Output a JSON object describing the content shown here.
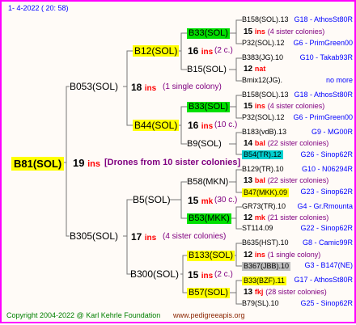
{
  "header": {
    "date": "1-   4-2022 ( 20:  58)"
  },
  "root": {
    "name": "B81(SOL)",
    "count": "19",
    "unit": "ins",
    "note": "[Drones from 10 sister colonies]"
  },
  "gen1": [
    {
      "name": "B053(SOL)",
      "count": "18",
      "unit": "ins",
      "note": "(1 single colony)"
    },
    {
      "name": "B305(SOL)",
      "count": "17",
      "unit": "ins",
      "note": "(4 sister colonies)"
    }
  ],
  "gen2": [
    {
      "name": "B12(SOL)",
      "count": "16",
      "unit": "ins",
      "note": "(2 c.)"
    },
    {
      "name": "B44(SOL)",
      "count": "16",
      "unit": "ins",
      "note": "(10 c.)"
    },
    {
      "name": "B5(SOL)",
      "count": "15",
      "unit": "mk",
      "note": "(30 c.)"
    },
    {
      "name": "B300(SOL)",
      "count": "15",
      "unit": "ins",
      "note": "(2 c.)"
    }
  ],
  "gen3": [
    {
      "name": "B33(SOL)",
      "count": "15",
      "unit": "ins",
      "note": "(4 sister colonies)"
    },
    {
      "name": "B15(SOL)",
      "count": "12",
      "unit": "nat",
      "note": ""
    },
    {
      "name": "B33(SOL)",
      "count": "15",
      "unit": "ins",
      "note": "(4 sister colonies)"
    },
    {
      "name": "B9(SOL)",
      "count": "14",
      "unit": "bal",
      "note": "(22 sister colonies)"
    },
    {
      "name": "B58(MKN)",
      "count": "13",
      "unit": "bal",
      "note": "(22 sister colonies)"
    },
    {
      "name": "B53(MKK)",
      "count": "12",
      "unit": "mk",
      "note": "(21 sister colonies)"
    },
    {
      "name": "B133(SOL)",
      "count": "12",
      "unit": "ins",
      "note": "(1 single colony)"
    },
    {
      "name": "B57(SOL)",
      "count": "13",
      "unit": "fkj",
      "note": "(28 sister colonies)"
    }
  ],
  "gen4": [
    {
      "name": "B158(SOL).13",
      "info": "G18 - AthosSt80R"
    },
    {
      "name": "P32(SOL).12",
      "info": "G6 - PrimGreen00"
    },
    {
      "name": "B383(JG).10",
      "info": "G10 - Takab93R"
    },
    {
      "name": "Bmix12(JG).",
      "info": "no more"
    },
    {
      "name": "B158(SOL).13",
      "info": "G18 - AthosSt80R"
    },
    {
      "name": "P32(SOL).12",
      "info": "G6 - PrimGreen00"
    },
    {
      "name": "B183(vdB).13",
      "info": "G9 - MG00R"
    },
    {
      "name": "B54(TR).12",
      "info": "G26 - Sinop62R"
    },
    {
      "name": "B129(TR).10",
      "info": "G10 - N06294R"
    },
    {
      "name": "B47(MKK).09",
      "info": "G23 - Sinop62R"
    },
    {
      "name": "GR73(TR).10",
      "info": "G4 - Gr.Rmounta"
    },
    {
      "name": "ST114.09",
      "info": "G22 - Sinop62R"
    },
    {
      "name": "B635(HST).10",
      "info": "G8 - Camic99R"
    },
    {
      "name": "B367(JBB).10",
      "info": "G3 - B147(NE)"
    },
    {
      "name": "B33(BZF).11",
      "info": "G17 - AthosSt80R"
    },
    {
      "name": "B79(SL).10",
      "info": "G25 - Sinop62R"
    }
  ],
  "footer": {
    "copyright": "Copyright 2004-2022 @ Karl Kehrle Foundation",
    "site": "www.pedigreeapis.org"
  },
  "colors": {
    "border": "#ff00ff",
    "yellow": "#ffff00",
    "green": "#00e000",
    "cyan": "#00d0d0",
    "gray": "#c0c0c0",
    "accent_red": "#ff0000",
    "link_blue": "#0000ff"
  }
}
